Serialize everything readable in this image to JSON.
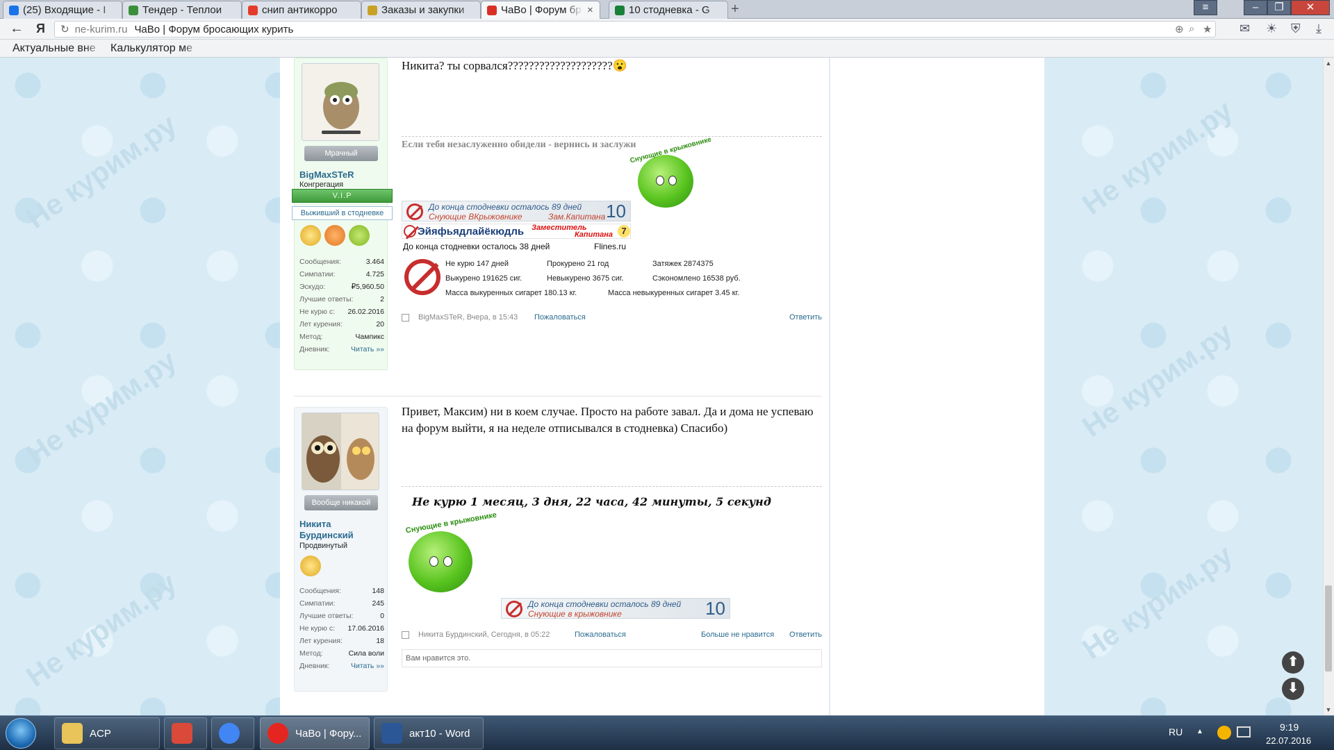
{
  "browser": {
    "tabs": [
      {
        "label": "(25) Входящие - I",
        "color": "#1a73e8"
      },
      {
        "label": "Тендер - Теплои",
        "color": "#3a8f3a"
      },
      {
        "label": "снип антикорро",
        "color": "#e43c2c"
      },
      {
        "label": "Заказы и закупки",
        "color": "#c9a225"
      },
      {
        "label": "ЧаВо | Форум бр",
        "color": "#d93025",
        "active": true
      },
      {
        "label": "10 стодневка - G",
        "color": "#188038"
      }
    ],
    "tab_close": "×",
    "new_tab": "+",
    "window_controls": {
      "min": "–",
      "max": "❐",
      "close": "✕"
    },
    "back": "←",
    "yandex": "Я",
    "reload": "↻",
    "url_domain": "ne-kurim.ru",
    "url_title": "ЧаВо | Форум бросающих курить",
    "url_tools": {
      "translate": "⊕",
      "zoom": "⌕",
      "star": "★"
    },
    "toolbar_icons": {
      "mail": "✉",
      "weather": "☀",
      "protect": "⛨",
      "download": "⤓"
    },
    "bookmarks": [
      "Актуальные вне",
      "Калькулятор ме"
    ]
  },
  "page": {
    "watermark": "Не курим.ру",
    "post1": {
      "mood": "Мрачный",
      "username": "BigMaxSTeR",
      "rank": "Конгрегация",
      "vip": "V.I.P",
      "badge": "Выживший в стодневке",
      "stats": [
        {
          "label": "Сообщения:",
          "value": "3.464"
        },
        {
          "label": "Симпатии:",
          "value": "4.725"
        },
        {
          "label": "Эскудо:",
          "value": "₽5,960.50"
        },
        {
          "label": "Лучшие ответы:",
          "value": "2"
        },
        {
          "label": "Не курю с:",
          "value": "26.02.2016"
        },
        {
          "label": "Лет курения:",
          "value": "20"
        },
        {
          "label": "Метод:",
          "value": "Чампикс"
        },
        {
          "label": "Дневник:",
          "value": "Читать »»"
        }
      ],
      "message": "Никита? ты сорвался????????????????????😮",
      "sig_quote": "Если тебя незаслуженно обидели - вернись и заслужи",
      "gooseberry_caption": "Снующие в крыжовнике",
      "banner1": {
        "line1": "До конца стодневки осталось 89 дней",
        "line2": "Снующие ВКрыжовнике",
        "line3": "Зам.Капитана",
        "num": "10"
      },
      "banner2": {
        "name": "Эйяфьядлайёкюдль",
        "role1": "Заместитель",
        "role2": "Капитана",
        "num": "7"
      },
      "ticker_left": "До конца стодневки осталось 38 дней",
      "ticker_right": "Flines.ru",
      "counter": [
        [
          "Не курю 147 дней",
          "Прокурено 21 год",
          "Затяжек 2874375"
        ],
        [
          "Выкурено 191625 сиг.",
          "Невыкурено 3675 сиг.",
          "Сэкономлено 16538 руб."
        ],
        [
          "Масса выкуренных сигарет 180.13 кг.",
          "Масса невыкуренных сигарет 3.45 кг."
        ]
      ],
      "footer_author": "BigMaxSTeR, Вчера, в 15:43",
      "report": "Пожаловаться",
      "reply": "Ответить"
    },
    "post2": {
      "mood": "Вообще никакой",
      "username_line1": "Никита",
      "username_line2": "Бурдинский",
      "rank": "Продвинутый",
      "stats": [
        {
          "label": "Сообщения:",
          "value": "148"
        },
        {
          "label": "Симпатии:",
          "value": "245"
        },
        {
          "label": "Лучшие ответы:",
          "value": "0"
        },
        {
          "label": "Не курю с:",
          "value": "17.06.2016"
        },
        {
          "label": "Лет курения:",
          "value": "18"
        },
        {
          "label": "Метод:",
          "value": "Сила воли"
        },
        {
          "label": "Дневник:",
          "value": "Читать »»"
        }
      ],
      "message": "Привет, Максим) ни в коем случае. Просто на работе завал. Да и дома не успеваю на форум выйти, я на неделе отписывался в стодневка) Спасибо)",
      "signature_timer": "Не курю 1 месяц, 3 дня, 22 часа, 42 минуты, 5 секунд",
      "gooseberry_caption": "Снующие в крыжовнике",
      "banner": {
        "line1": "До конца стодневки осталось 89 дней",
        "line2": "Снующие в крыжовнике",
        "num": "10"
      },
      "footer_author": "Никита Бурдинский, Сегодня, в 05:22",
      "report": "Пожаловаться",
      "unlike": "Больше не нравится",
      "reply": "Ответить",
      "like_text": "Вам нравится это."
    },
    "scroll_up": "⬆",
    "scroll_down": "⬇",
    "scrollbar_up": "▲",
    "scrollbar_down": "▼"
  },
  "taskbar": {
    "items": [
      {
        "label": "ACP",
        "color": "#e8c45a"
      },
      {
        "label": "",
        "color": "#d94a3a"
      },
      {
        "label": "",
        "color": "#4285f4"
      },
      {
        "label": "ЧаВо | Фору...",
        "color": "#e52620",
        "active": true
      },
      {
        "label": "акт10 - Word",
        "color": "#2b5797"
      }
    ],
    "lang": "RU",
    "tray_arrow": "▲",
    "time": "9:19",
    "date": "22.07.2016"
  }
}
